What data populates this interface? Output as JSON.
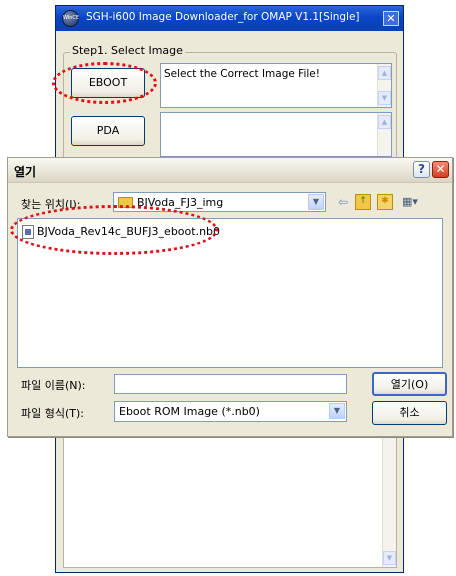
{
  "downloader": {
    "title": "SGH-i600 Image Downloader_for OMAP V1.1[Single]",
    "app_icon_text": "WinCE",
    "close_glyph": "✕",
    "group_label": "Step1. Select Image",
    "eboot_button_label": "EBOOT",
    "eboot_path_text": "Select the Correct Image File!",
    "pda_button_label": "PDA",
    "pda_path_text": "",
    "scroll_up_glyph": "▲",
    "scroll_down_glyph": "▼",
    "highlight_color": "#e0101a"
  },
  "dialog": {
    "title": "열기",
    "help_label": "?",
    "close_label": "✕",
    "look_in_label": "찾는 위치(I):",
    "look_in_value": "BJVoda_FJ3_img",
    "combo_arrow_glyph": "▼",
    "toolbar": {
      "back_glyph": "⇦",
      "up_folder_glyph": "↑",
      "new_folder_glyph": "✱",
      "view_menu_glyph": "▦▾"
    },
    "files": [
      {
        "name": "BJVoda_Rev14c_BUFJ3_eboot.nb0",
        "icon": "file-icon"
      }
    ],
    "filename_label": "파일 이름(N):",
    "filename_value": "",
    "filetype_label": "파일 형식(T):",
    "filetype_value": "Eboot ROM Image (*.nb0)",
    "open_button_label": "열기(O)",
    "cancel_button_label": "취소"
  }
}
